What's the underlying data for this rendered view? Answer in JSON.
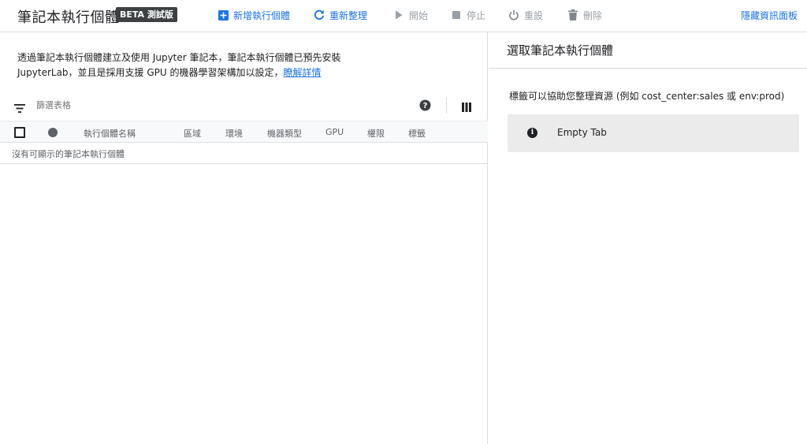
{
  "header": {
    "title": "筆記本執行個體",
    "badge": "BETA 測試版",
    "actions": [
      {
        "label": "新增執行個體",
        "icon": "add-box-icon",
        "enabled": true
      },
      {
        "label": "重新整理",
        "icon": "refresh-icon",
        "enabled": true
      },
      {
        "label": "開始",
        "icon": "play-icon",
        "enabled": false
      },
      {
        "label": "停止",
        "icon": "stop-icon",
        "enabled": false
      },
      {
        "label": "重設",
        "icon": "power-icon",
        "enabled": false
      },
      {
        "label": "刪除",
        "icon": "trash-icon",
        "enabled": false
      }
    ],
    "hide_panel": "隱藏資訊面板"
  },
  "intro": {
    "line1": "透過筆記本執行個體建立及使用 Jupyter 筆記本，筆記本執行個體已預先安裝",
    "line2": "JupyterLab，並且是採用支援 GPU 的機器學習架構加以設定，",
    "link": "瞭解詳情"
  },
  "filter": {
    "placeholder": "篩選表格"
  },
  "table": {
    "columns": [
      "執行個體名稱",
      "區域",
      "環境",
      "機器類型",
      "GPU",
      "權限",
      "標籤"
    ],
    "empty_message": "沒有可顯示的筆記本執行個體"
  },
  "info_panel": {
    "title": "選取筆記本執行個體",
    "description": "標籤可以協助您整理資源 (例如 cost_center:sales 或 env:prod)",
    "empty_tab": "Empty Tab"
  },
  "colors": {
    "accent": "#1a73e8",
    "disabled": "#9aa0a6",
    "badge_bg": "#3c4043"
  }
}
